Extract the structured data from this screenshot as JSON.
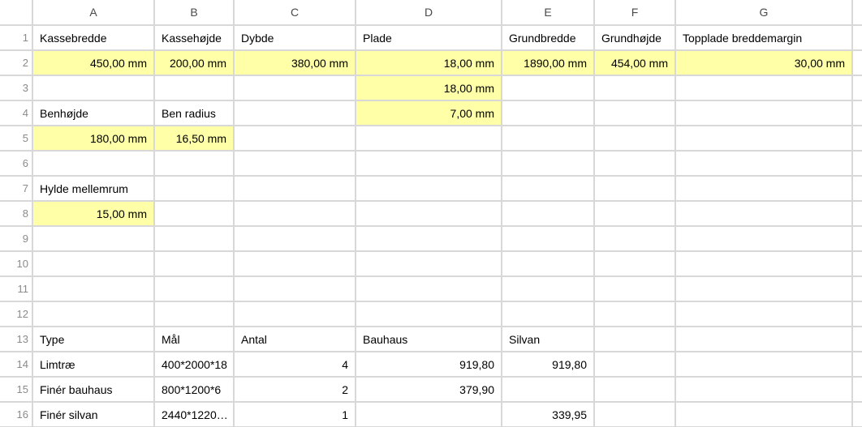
{
  "chart_data": {
    "type": "table",
    "columns": [
      "A",
      "B",
      "C",
      "D",
      "E",
      "F",
      "G"
    ],
    "rows": [
      {
        "A": "Kassebredde",
        "B": "Kassehøjde",
        "C": "Dybde",
        "D": "Plade",
        "E": "Grundbredde",
        "F": "Grundhøjde",
        "G": "Topplade breddemargin"
      },
      {
        "A": "450,00 mm",
        "B": "200,00 mm",
        "C": "380,00 mm",
        "D": "18,00 mm",
        "E": "1890,00 mm",
        "F": "454,00 mm",
        "G": "30,00 mm"
      },
      {
        "D": "18,00 mm"
      },
      {
        "A": "Benhøjde",
        "B": "Ben radius",
        "D": "7,00 mm"
      },
      {
        "A": "180,00 mm",
        "B": "16,50 mm"
      },
      {},
      {
        "A": "Hylde mellemrum"
      },
      {
        "A": "15,00 mm"
      },
      {},
      {},
      {},
      {},
      {
        "A": "Type",
        "B": "Mål",
        "C": "Antal",
        "D": "Bauhaus",
        "E": "Silvan"
      },
      {
        "A": "Limtræ",
        "B": "400*2000*18",
        "C": "4",
        "D": "919,80",
        "E": "919,80"
      },
      {
        "A": "Finér bauhaus",
        "B": "800*1200*6",
        "C": "2",
        "D": "379,90"
      },
      {
        "A": "Finér silvan",
        "B": "2440*1220…",
        "C": "1",
        "E": "339,95"
      }
    ]
  },
  "colHeaders": [
    "A",
    "B",
    "C",
    "D",
    "E",
    "F",
    "G"
  ],
  "rowCount": 16,
  "colWidths": {
    "rowhdr": 40,
    "A": 150,
    "B": 98,
    "C": 150,
    "D": 180,
    "E": 114,
    "F": 100,
    "G": 218,
    "tail": 24
  },
  "cells": {
    "r1": {
      "A": {
        "v": "Kassebredde",
        "a": "text"
      },
      "B": {
        "v": "Kassehøjde",
        "a": "text"
      },
      "C": {
        "v": "Dybde",
        "a": "text"
      },
      "D": {
        "v": "Plade",
        "a": "text"
      },
      "E": {
        "v": "Grundbredde",
        "a": "text"
      },
      "F": {
        "v": "Grundhøjde",
        "a": "text"
      },
      "G": {
        "v": "Topplade breddemargin",
        "a": "text"
      }
    },
    "r2": {
      "A": {
        "v": "450,00 mm",
        "a": "num",
        "hl": true
      },
      "B": {
        "v": "200,00 mm",
        "a": "num",
        "hl": true
      },
      "C": {
        "v": "380,00 mm",
        "a": "num",
        "hl": true
      },
      "D": {
        "v": "18,00 mm",
        "a": "num",
        "hl": true
      },
      "E": {
        "v": "1890,00 mm",
        "a": "num",
        "hl": true
      },
      "F": {
        "v": "454,00 mm",
        "a": "num",
        "hl": true
      },
      "G": {
        "v": "30,00 mm",
        "a": "num",
        "hl": true
      }
    },
    "r3": {
      "D": {
        "v": "18,00 mm",
        "a": "num",
        "hl": true
      }
    },
    "r4": {
      "A": {
        "v": "Benhøjde",
        "a": "text"
      },
      "B": {
        "v": "Ben radius",
        "a": "text"
      },
      "D": {
        "v": "7,00 mm",
        "a": "num",
        "hl": true
      }
    },
    "r5": {
      "A": {
        "v": "180,00 mm",
        "a": "num",
        "hl": true
      },
      "B": {
        "v": "16,50 mm",
        "a": "num",
        "hl": true
      }
    },
    "r6": {},
    "r7": {
      "A": {
        "v": "Hylde mellemrum",
        "a": "text"
      }
    },
    "r8": {
      "A": {
        "v": "15,00 mm",
        "a": "num",
        "hl": true
      }
    },
    "r9": {},
    "r10": {},
    "r11": {},
    "r12": {},
    "r13": {
      "A": {
        "v": "Type",
        "a": "text"
      },
      "B": {
        "v": "Mål",
        "a": "text"
      },
      "C": {
        "v": "Antal",
        "a": "text"
      },
      "D": {
        "v": "Bauhaus",
        "a": "text"
      },
      "E": {
        "v": "Silvan",
        "a": "text"
      }
    },
    "r14": {
      "A": {
        "v": "Limtræ",
        "a": "text"
      },
      "B": {
        "v": "400*2000*18",
        "a": "text"
      },
      "C": {
        "v": "4",
        "a": "num"
      },
      "D": {
        "v": "919,80",
        "a": "num"
      },
      "E": {
        "v": "919,80",
        "a": "num"
      }
    },
    "r15": {
      "A": {
        "v": "Finér bauhaus",
        "a": "text"
      },
      "B": {
        "v": "800*1200*6",
        "a": "text"
      },
      "C": {
        "v": "2",
        "a": "num"
      },
      "D": {
        "v": "379,90",
        "a": "num"
      }
    },
    "r16": {
      "A": {
        "v": "Finér silvan",
        "a": "text"
      },
      "B": {
        "v": "2440*1220…",
        "a": "text"
      },
      "C": {
        "v": "1",
        "a": "num"
      },
      "E": {
        "v": "339,95",
        "a": "num"
      }
    }
  }
}
